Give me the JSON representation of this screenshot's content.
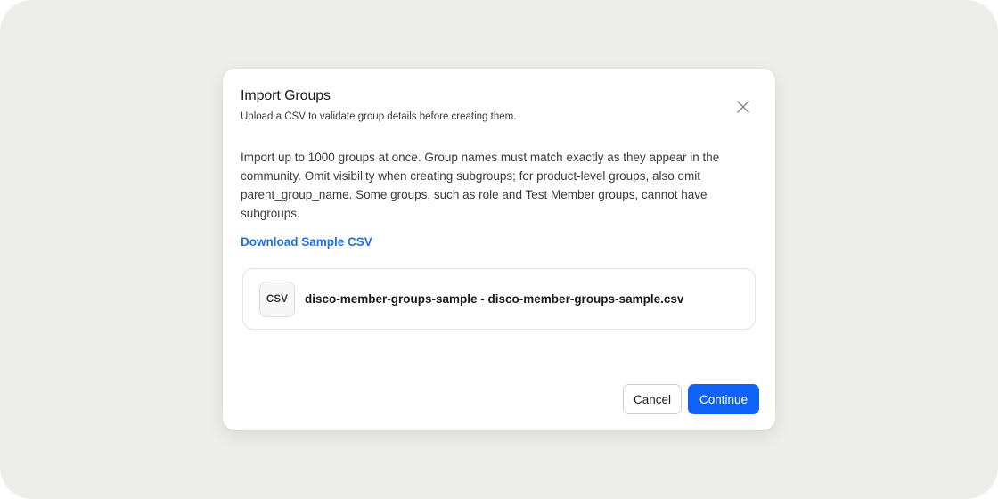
{
  "modal": {
    "title": "Import Groups",
    "subtitle": "Upload a CSV to validate group details before creating them.",
    "close_icon": "close-icon",
    "description": "Import up to 1000 groups at once. Group names must match exactly as they appear in the community. Omit visibility when creating subgroups; for product-level groups, also omit parent_group_name. Some groups, such as role and Test Member groups, cannot have subgroups.",
    "download_link": "Download Sample CSV",
    "file": {
      "type_label": "CSV",
      "name": "disco-member-groups-sample - disco-member-groups-sample.csv"
    },
    "buttons": {
      "cancel": "Cancel",
      "continue": "Continue"
    }
  },
  "colors": {
    "backdrop": "#ededea",
    "accent": "#0f62f5",
    "link": "#1f6fe5"
  }
}
